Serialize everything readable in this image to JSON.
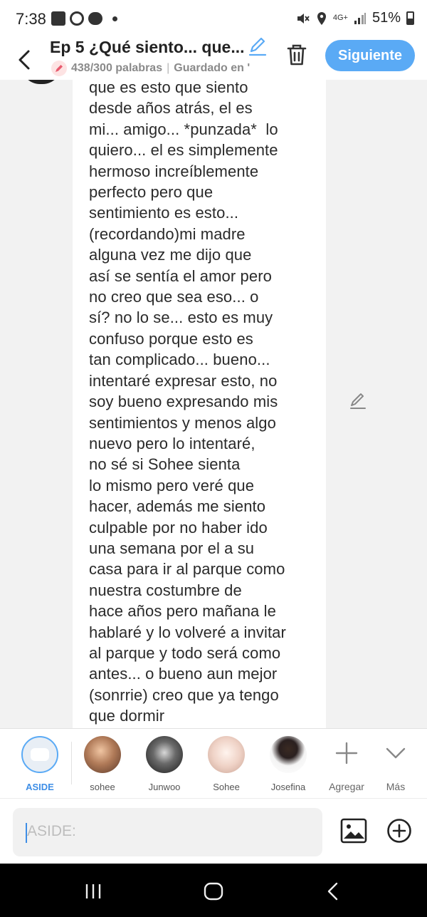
{
  "status_bar": {
    "time": "7:38",
    "network": "4G+",
    "battery": "51%",
    "icons": [
      "gallery-icon",
      "whatsapp-icon",
      "chat-icon",
      "mute-icon",
      "location-icon",
      "signal-icon",
      "battery-icon"
    ]
  },
  "header": {
    "title": "Ep 5 ¿Qué siento... que...",
    "word_count": "438/300 palabras",
    "separator": "|",
    "saved_status": "Guardado en '",
    "next_button": "Siguiente"
  },
  "content": {
    "text": "que es esto que siento\ndesde años atrás, el es\nmi... amigo... *punzada*  lo\nquiero... el es simplemente\nhermoso increíblemente\nperfecto pero que\nsentimiento es esto...\n(recordando)mi madre\nalguna vez me dijo que\nasí se sentía el amor pero\nno creo que sea eso... o\nsí? no lo se... esto es muy\nconfuso porque esto es\ntan complicado... bueno...\nintentaré expresar esto, no\nsoy bueno expresando mis\nsentimientos y menos algo\nnuevo pero lo intentaré,\nno sé si Sohee sienta\nlo mismo pero veré que\nhacer, además me siento\nculpable por no haber ido\nuna semana por el a su\ncasa para ir al parque como\nnuestra costumbre de\nhace años pero mañana le\nhablaré y lo volveré a invitar\nal parque y todo será como\nantes... o bueno aun mejor\n(sonrrie) creo que ya tengo\nque dormir"
  },
  "characters": [
    {
      "name": "ASIDE",
      "selected": true
    },
    {
      "name": "sohee"
    },
    {
      "name": "Junwoo"
    },
    {
      "name": "Sohee"
    },
    {
      "name": "Josefina"
    }
  ],
  "actions": {
    "add_label": "Agregar",
    "more_label": "Más"
  },
  "input": {
    "placeholder": "ASIDE:"
  },
  "colors": {
    "accent": "#5aaaf5",
    "underline": "#f08a24",
    "text": "#2a2a2a"
  }
}
